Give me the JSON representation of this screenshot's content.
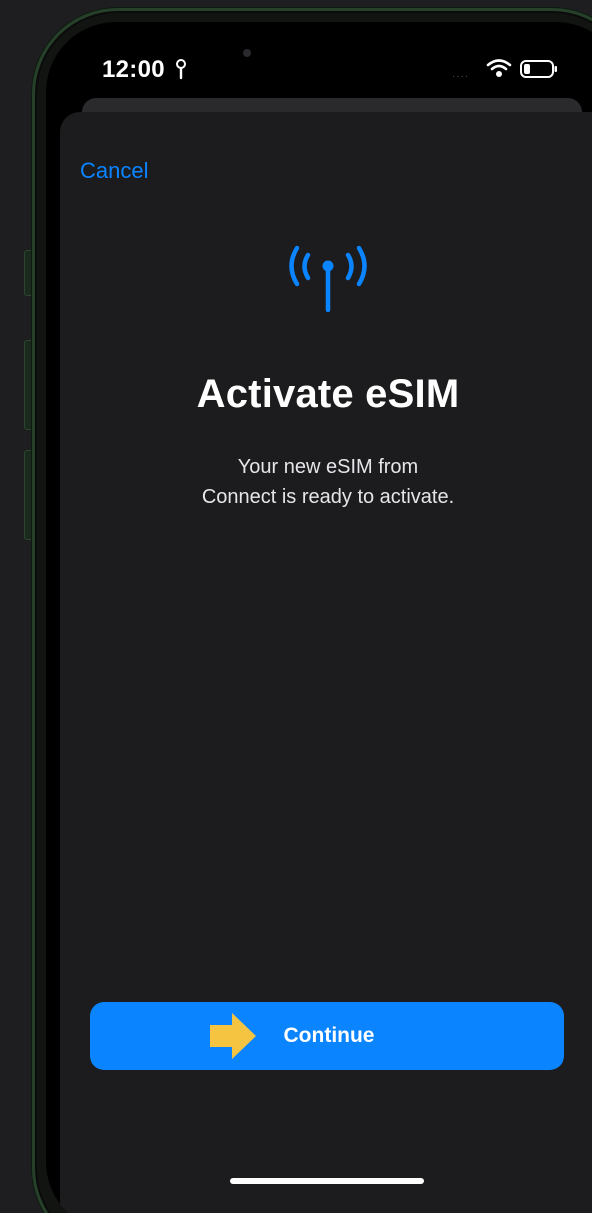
{
  "status_bar": {
    "time": "12:00",
    "location_icon": "location-arrow-icon",
    "wifi_icon": "wifi-icon",
    "battery_icon": "battery-icon"
  },
  "sheet": {
    "cancel_label": "Cancel",
    "hero_icon": "antenna-signal-icon",
    "title": "Activate eSIM",
    "subtitle_line1": "Your new eSIM from",
    "subtitle_line2": "Connect is ready to activate.",
    "continue_label": "Continue",
    "pointer_icon": "arrow-right-icon"
  },
  "colors": {
    "accent": "#0a84ff",
    "background": "#1c1c1e",
    "pointer": "#f5c542"
  }
}
